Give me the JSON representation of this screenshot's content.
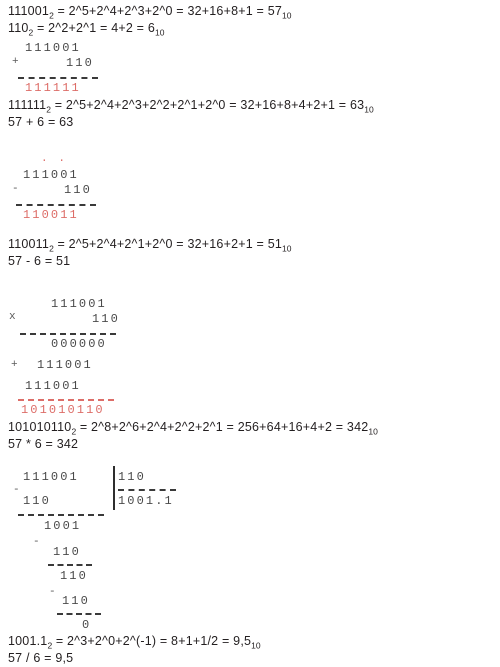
{
  "document": {
    "title": "Binary arithmetic worked examples",
    "accent_red": "#dd6d68",
    "text_color": "#231f20"
  },
  "conversions": {
    "line1_main": "111001",
    "line1_sub": "2",
    "line1_rest": " = 2^5+2^4+2^3+2^0 = 32+16+8+1 = 57",
    "line1_tail_sub": "10",
    "line2_main": "110",
    "line2_sub": "2",
    "line2_rest": " = 2^2+2^1 = 4+2 = 6",
    "line2_tail_sub": "10"
  },
  "addition": {
    "operator": "+",
    "operand1": "111001",
    "operand2": "110",
    "result": "111111",
    "result_line_main": "111111",
    "result_line_sub": "2",
    "result_line_rest": " = 2^5+2^4+2^3+2^2+2^1+2^0 = 32+16+8+4+2+1 = 63",
    "result_line_tail_sub": "10",
    "check": "57 + 6 = 63"
  },
  "subtraction": {
    "operator": "-",
    "borrow_marks": ". .",
    "operand1": "111001",
    "operand2": "110",
    "result": "110011",
    "result_line_main": "110011",
    "result_line_sub": "2",
    "result_line_rest": " = 2^5+2^4+2^1+2^0 = 32+16+2+1 = 51",
    "result_line_tail_sub": "10",
    "check": "57 - 6 = 51"
  },
  "multiplication": {
    "operator": "x",
    "operand1": "111001",
    "operand2": "110",
    "plus_operator": "+",
    "partial1": "000000",
    "partial2": "111001",
    "partial3": "111001",
    "result": "101010110",
    "result_line_main": "101010110",
    "result_line_sub": "2",
    "result_line_rest": " = 2^8+2^6+2^4+2^2+2^1 = 256+64+16+4+2 = 342",
    "result_line_tail_sub": "10",
    "check": "57 * 6 = 342"
  },
  "division": {
    "dividend": "111001",
    "divisor": "110",
    "quotient": "1001.1",
    "minus1": "-",
    "sub1": "110",
    "rem1": "1001",
    "minus2": "-",
    "sub2": "110",
    "rem2": "110",
    "minus3": "-",
    "sub3": "110",
    "rem3": "0",
    "result_line_main": "1001.1",
    "result_line_sub": "2",
    "result_line_rest": " = 2^3+2^0+2^(-1) = 8+1+1/2 = 9,5",
    "result_line_tail_sub": "10",
    "check": "57 / 6 = 9,5"
  }
}
